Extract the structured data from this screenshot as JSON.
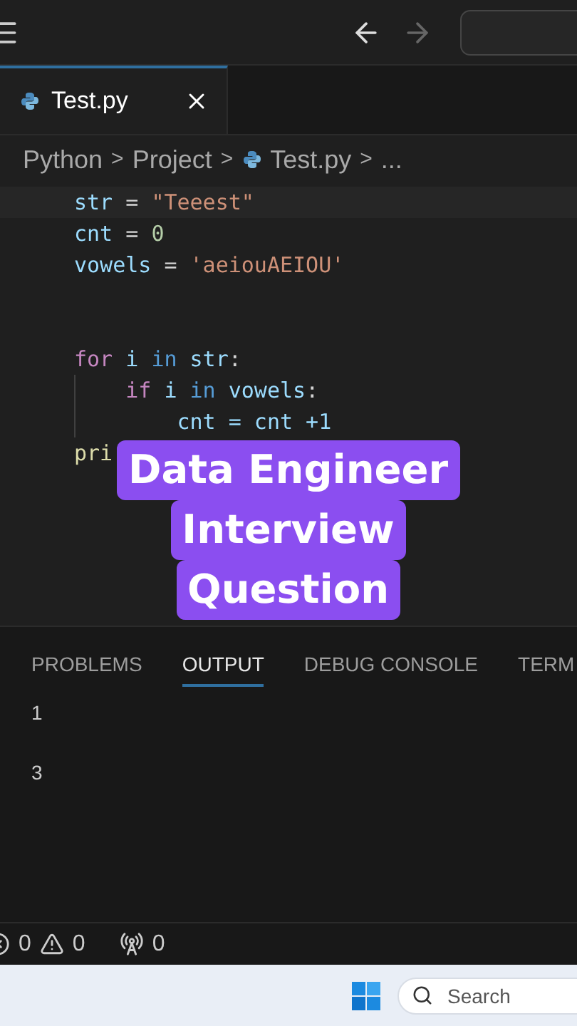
{
  "title_bar": {
    "nav": [
      {
        "kind": "back",
        "disabled": false
      },
      {
        "kind": "forward",
        "disabled": true
      }
    ]
  },
  "tabs": [
    {
      "label": "Test.py",
      "selected": true
    }
  ],
  "breadcrumb": [
    {
      "label": "Python",
      "separator": ">"
    },
    {
      "label": "Project",
      "separator": ">"
    },
    {
      "label": "Test.py",
      "separator": ">"
    },
    {
      "label": "..."
    }
  ],
  "code": [
    {
      "kind": "code",
      "tokens": [
        {
          "kind": "var",
          "text": "str"
        },
        {
          "kind": "op",
          "text": " = "
        },
        {
          "kind": "string",
          "text": "\"Teeest\""
        }
      ],
      "guide": false
    },
    {
      "kind": "code",
      "tokens": [
        {
          "kind": "var",
          "text": "cnt"
        },
        {
          "kind": "op",
          "text": " = "
        },
        {
          "kind": "number",
          "text": "0"
        }
      ],
      "guide": false
    },
    {
      "kind": "code",
      "tokens": [
        {
          "kind": "var",
          "text": "vowels"
        },
        {
          "kind": "op",
          "text": " = "
        },
        {
          "kind": "string",
          "text": "'aeiouAEIOU'"
        }
      ],
      "guide": false
    },
    {
      "kind": "blank"
    },
    {
      "kind": "blank"
    },
    {
      "kind": "code",
      "tokens": [
        {
          "kind": "keyword",
          "text": "for"
        },
        {
          "kind": "var",
          "text": " i "
        },
        {
          "kind": "builtin",
          "text": "in"
        },
        {
          "kind": "var",
          "text": " str"
        },
        {
          "kind": "op",
          "text": ":"
        }
      ],
      "guide": false
    },
    {
      "kind": "code",
      "tokens": [
        {
          "kind": "keyword",
          "text": "    if"
        },
        {
          "kind": "var",
          "text": " i "
        },
        {
          "kind": "builtin",
          "text": "in"
        },
        {
          "kind": "var",
          "text": " vowels"
        },
        {
          "kind": "op",
          "text": ":"
        }
      ],
      "guide": true
    },
    {
      "kind": "code",
      "tokens": [
        {
          "kind": "var",
          "text": "        cnt = cnt +1"
        }
      ],
      "guide": true
    },
    {
      "kind": "code",
      "tokens": [
        {
          "kind": "func",
          "text": "pri"
        }
      ],
      "guide": false
    }
  ],
  "caption": [
    "Data Engineer",
    "Interview",
    "Question"
  ],
  "panel": {
    "tabs": [
      {
        "label": "PROBLEMS",
        "selected": false
      },
      {
        "label": "OUTPUT",
        "selected": true
      },
      {
        "label": "DEBUG CONSOLE",
        "selected": false
      },
      {
        "label": "TERM",
        "selected": false
      }
    ],
    "output": [
      {
        "kind": "line",
        "text": "1"
      },
      {
        "kind": "blank"
      },
      {
        "kind": "line",
        "text": "3"
      }
    ]
  },
  "status_bar": [
    {
      "kind": "errors",
      "text": "0"
    },
    {
      "kind": "warnings",
      "text": "0"
    },
    {
      "kind": "ports",
      "text": "0"
    }
  ],
  "taskbar": {
    "search": {
      "placeholder": "Search"
    }
  }
}
